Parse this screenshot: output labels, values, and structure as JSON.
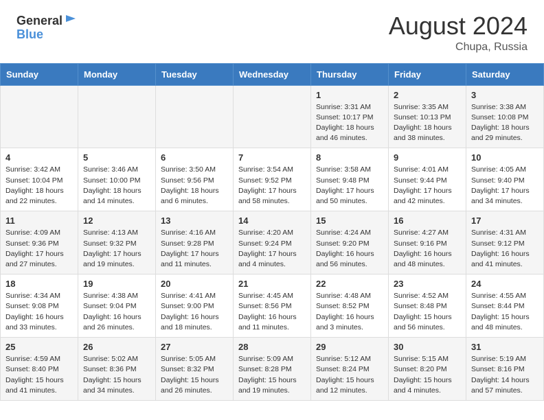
{
  "header": {
    "logo_general": "General",
    "logo_blue": "Blue",
    "month_year": "August 2024",
    "location": "Chupa, Russia"
  },
  "days_of_week": [
    "Sunday",
    "Monday",
    "Tuesday",
    "Wednesday",
    "Thursday",
    "Friday",
    "Saturday"
  ],
  "weeks": [
    [
      {
        "day": "",
        "sunrise": "",
        "sunset": "",
        "daylight": ""
      },
      {
        "day": "",
        "sunrise": "",
        "sunset": "",
        "daylight": ""
      },
      {
        "day": "",
        "sunrise": "",
        "sunset": "",
        "daylight": ""
      },
      {
        "day": "",
        "sunrise": "",
        "sunset": "",
        "daylight": ""
      },
      {
        "day": "1",
        "sunrise": "3:31 AM",
        "sunset": "10:17 PM",
        "daylight": "18 hours and 46 minutes."
      },
      {
        "day": "2",
        "sunrise": "3:35 AM",
        "sunset": "10:13 PM",
        "daylight": "18 hours and 38 minutes."
      },
      {
        "day": "3",
        "sunrise": "3:38 AM",
        "sunset": "10:08 PM",
        "daylight": "18 hours and 29 minutes."
      }
    ],
    [
      {
        "day": "4",
        "sunrise": "3:42 AM",
        "sunset": "10:04 PM",
        "daylight": "18 hours and 22 minutes."
      },
      {
        "day": "5",
        "sunrise": "3:46 AM",
        "sunset": "10:00 PM",
        "daylight": "18 hours and 14 minutes."
      },
      {
        "day": "6",
        "sunrise": "3:50 AM",
        "sunset": "9:56 PM",
        "daylight": "18 hours and 6 minutes."
      },
      {
        "day": "7",
        "sunrise": "3:54 AM",
        "sunset": "9:52 PM",
        "daylight": "17 hours and 58 minutes."
      },
      {
        "day": "8",
        "sunrise": "3:58 AM",
        "sunset": "9:48 PM",
        "daylight": "17 hours and 50 minutes."
      },
      {
        "day": "9",
        "sunrise": "4:01 AM",
        "sunset": "9:44 PM",
        "daylight": "17 hours and 42 minutes."
      },
      {
        "day": "10",
        "sunrise": "4:05 AM",
        "sunset": "9:40 PM",
        "daylight": "17 hours and 34 minutes."
      }
    ],
    [
      {
        "day": "11",
        "sunrise": "4:09 AM",
        "sunset": "9:36 PM",
        "daylight": "17 hours and 27 minutes."
      },
      {
        "day": "12",
        "sunrise": "4:13 AM",
        "sunset": "9:32 PM",
        "daylight": "17 hours and 19 minutes."
      },
      {
        "day": "13",
        "sunrise": "4:16 AM",
        "sunset": "9:28 PM",
        "daylight": "17 hours and 11 minutes."
      },
      {
        "day": "14",
        "sunrise": "4:20 AM",
        "sunset": "9:24 PM",
        "daylight": "17 hours and 4 minutes."
      },
      {
        "day": "15",
        "sunrise": "4:24 AM",
        "sunset": "9:20 PM",
        "daylight": "16 hours and 56 minutes."
      },
      {
        "day": "16",
        "sunrise": "4:27 AM",
        "sunset": "9:16 PM",
        "daylight": "16 hours and 48 minutes."
      },
      {
        "day": "17",
        "sunrise": "4:31 AM",
        "sunset": "9:12 PM",
        "daylight": "16 hours and 41 minutes."
      }
    ],
    [
      {
        "day": "18",
        "sunrise": "4:34 AM",
        "sunset": "9:08 PM",
        "daylight": "16 hours and 33 minutes."
      },
      {
        "day": "19",
        "sunrise": "4:38 AM",
        "sunset": "9:04 PM",
        "daylight": "16 hours and 26 minutes."
      },
      {
        "day": "20",
        "sunrise": "4:41 AM",
        "sunset": "9:00 PM",
        "daylight": "16 hours and 18 minutes."
      },
      {
        "day": "21",
        "sunrise": "4:45 AM",
        "sunset": "8:56 PM",
        "daylight": "16 hours and 11 minutes."
      },
      {
        "day": "22",
        "sunrise": "4:48 AM",
        "sunset": "8:52 PM",
        "daylight": "16 hours and 3 minutes."
      },
      {
        "day": "23",
        "sunrise": "4:52 AM",
        "sunset": "8:48 PM",
        "daylight": "15 hours and 56 minutes."
      },
      {
        "day": "24",
        "sunrise": "4:55 AM",
        "sunset": "8:44 PM",
        "daylight": "15 hours and 48 minutes."
      }
    ],
    [
      {
        "day": "25",
        "sunrise": "4:59 AM",
        "sunset": "8:40 PM",
        "daylight": "15 hours and 41 minutes."
      },
      {
        "day": "26",
        "sunrise": "5:02 AM",
        "sunset": "8:36 PM",
        "daylight": "15 hours and 34 minutes."
      },
      {
        "day": "27",
        "sunrise": "5:05 AM",
        "sunset": "8:32 PM",
        "daylight": "15 hours and 26 minutes."
      },
      {
        "day": "28",
        "sunrise": "5:09 AM",
        "sunset": "8:28 PM",
        "daylight": "15 hours and 19 minutes."
      },
      {
        "day": "29",
        "sunrise": "5:12 AM",
        "sunset": "8:24 PM",
        "daylight": "15 hours and 12 minutes."
      },
      {
        "day": "30",
        "sunrise": "5:15 AM",
        "sunset": "8:20 PM",
        "daylight": "15 hours and 4 minutes."
      },
      {
        "day": "31",
        "sunrise": "5:19 AM",
        "sunset": "8:16 PM",
        "daylight": "14 hours and 57 minutes."
      }
    ]
  ],
  "labels": {
    "sunrise": "Sunrise:",
    "sunset": "Sunset:",
    "daylight": "Daylight:"
  }
}
